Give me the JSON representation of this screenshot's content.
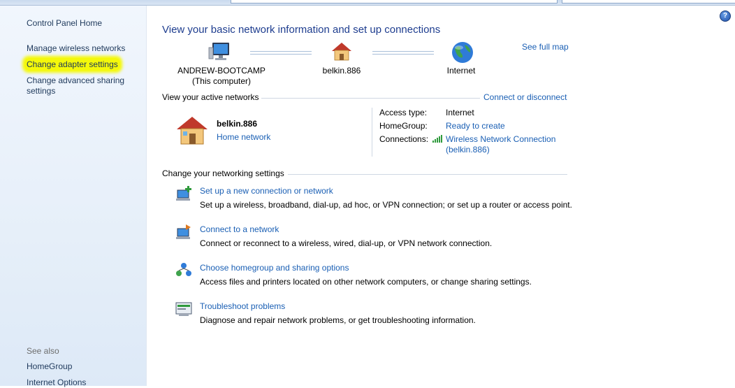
{
  "sidebar": {
    "home": "Control Panel Home",
    "links": [
      "Manage wireless networks",
      "Change adapter settings",
      "Change advanced sharing",
      "settings"
    ],
    "see_also_label": "See also",
    "see_also": [
      "HomeGroup",
      "Internet Options"
    ]
  },
  "main": {
    "title": "View your basic network information and set up connections",
    "see_full_map": "See full map",
    "map": {
      "computer_name": "ANDREW-BOOTCAMP",
      "computer_sub": "(This computer)",
      "router": "belkin.886",
      "internet": "Internet"
    },
    "active": {
      "heading": "View your active networks",
      "connect_link": "Connect or disconnect",
      "network_name": "belkin.886",
      "network_type": "Home network",
      "access_type_label": "Access type:",
      "access_type_value": "Internet",
      "homegroup_label": "HomeGroup:",
      "homegroup_value": "Ready to create",
      "connections_label": "Connections:",
      "connection_line1": "Wireless Network Connection",
      "connection_line2": "(belkin.886)"
    },
    "settings": {
      "heading": "Change your networking settings",
      "tasks": [
        {
          "title": "Set up a new connection or network",
          "desc": "Set up a wireless, broadband, dial-up, ad hoc, or VPN connection; or set up a router or access point."
        },
        {
          "title": "Connect to a network",
          "desc": "Connect or reconnect to a wireless, wired, dial-up, or VPN network connection."
        },
        {
          "title": "Choose homegroup and sharing options",
          "desc": "Access files and printers located on other network computers, or change sharing settings."
        },
        {
          "title": "Troubleshoot problems",
          "desc": "Diagnose and repair network problems, or get troubleshooting information."
        }
      ]
    },
    "help_glyph": "?"
  },
  "colors": {
    "link": "#1a5fb4",
    "title": "#1e3d8f",
    "highlight": "#f4f80a",
    "sidebar_bg": "#e6eff9"
  },
  "icons": [
    "computer-icon",
    "house-icon",
    "globe-icon",
    "signal-bars-icon",
    "help-icon",
    "new-connection-icon",
    "connect-network-icon",
    "homegroup-icon",
    "troubleshoot-icon"
  ]
}
